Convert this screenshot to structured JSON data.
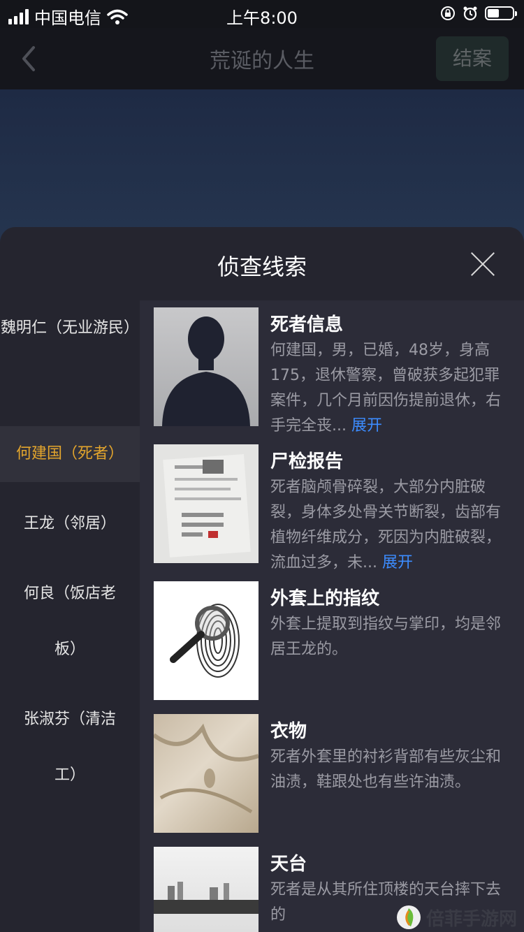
{
  "status_bar": {
    "carrier": "中国电信",
    "time": "上午8:00",
    "battery_level": 0.45
  },
  "nav": {
    "title": "荒诞的人生",
    "close_case_label": "结案",
    "back_icon": "chevron-left-icon"
  },
  "panel": {
    "title": "侦查线索"
  },
  "suspects": [
    {
      "label": "魏明仁（无业游民）"
    },
    {
      "label": "何建国（死者）",
      "active": true
    },
    {
      "label": "王龙（邻居）"
    },
    {
      "label": "何良（饭店老板）"
    },
    {
      "label": "张淑芬（清洁工）"
    }
  ],
  "clues": [
    {
      "title": "死者信息",
      "desc": "何建国，男，已婚，48岁，身高175，退休警察，曾破获多起犯罪案件，几个月前因伤提前退休，右手完全丧...",
      "expand": "展开"
    },
    {
      "title": "尸检报告",
      "desc": "死者脑颅骨碎裂，大部分内脏破裂，身体多处骨关节断裂，齿部有植物纤维成分，死因为内脏破裂，流血过多，未...",
      "expand": "展开"
    },
    {
      "title": "外套上的指纹",
      "desc": "外套上提取到指纹与掌印，均是邻居王龙的。"
    },
    {
      "title": "衣物",
      "desc": "死者外套里的衬衫背部有些灰尘和油渍，鞋跟处也有些许油渍。"
    },
    {
      "title": "天台",
      "desc": "死者是从其所住顶楼的天台摔下去的"
    }
  ],
  "watermark": {
    "text": "倍菲手游网"
  }
}
